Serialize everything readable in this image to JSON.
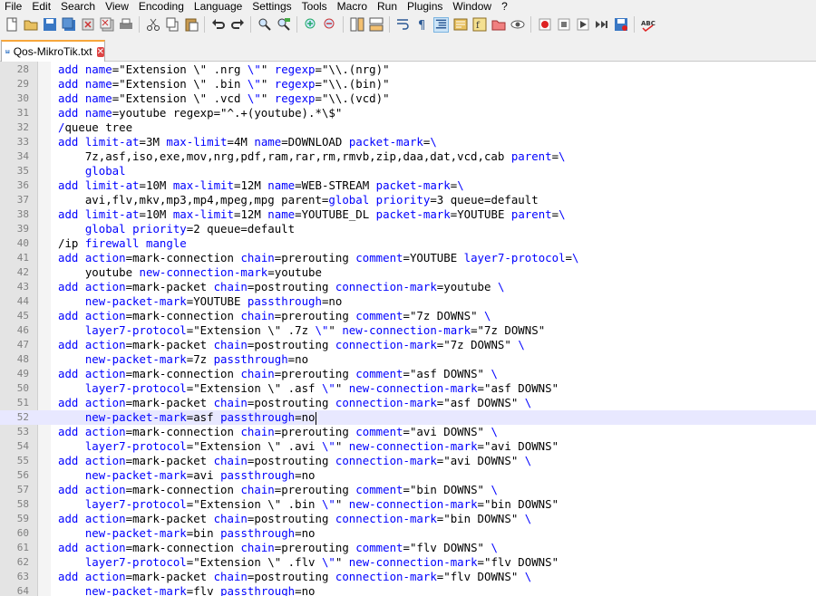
{
  "menu": [
    "File",
    "Edit",
    "Search",
    "View",
    "Encoding",
    "Language",
    "Settings",
    "Tools",
    "Macro",
    "Run",
    "Plugins",
    "Window",
    "?"
  ],
  "toolbar": {
    "groups": [
      [
        "new-file-icon",
        "open-file-icon",
        "save-icon",
        "save-all-icon",
        "close-icon",
        "close-all-icon",
        "print-icon"
      ],
      [
        "cut-icon",
        "copy-icon",
        "paste-icon"
      ],
      [
        "undo-icon",
        "redo-icon"
      ],
      [
        "find-icon",
        "replace-icon"
      ],
      [
        "zoom-in-icon",
        "zoom-out-icon"
      ],
      [
        "sync-vertical-icon",
        "sync-horizontal-icon"
      ],
      [
        "word-wrap-icon",
        "show-all-characters-icon",
        "indent-guide-icon",
        "document-map-icon",
        "function-list-icon",
        "folder-workspace-icon",
        "monitoring-icon"
      ],
      [
        "record-macro-icon",
        "stop-recording-icon",
        "play-macro-icon",
        "run-macro-multiple-icon",
        "save-macro-icon"
      ],
      [
        "spell-check-icon"
      ]
    ],
    "active": [
      "indent-guide-icon"
    ],
    "spell_label": "ABC"
  },
  "tab": {
    "label": "Qos-MikroTik.txt"
  },
  "current_line": 52,
  "lines": [
    {
      "n": "28",
      "t": [
        [
          "kw",
          "add "
        ],
        [
          "kw",
          "name"
        ],
        [
          "v",
          "=\"Extension \\\" .nrg "
        ],
        [
          "kw",
          "\\\""
        ],
        [
          "v",
          "\" "
        ],
        [
          "kw",
          "regexp"
        ],
        [
          "v",
          "=\"\\\\.(nrg)\""
        ]
      ]
    },
    {
      "n": "29",
      "t": [
        [
          "kw",
          "add "
        ],
        [
          "kw",
          "name"
        ],
        [
          "v",
          "=\"Extension \\\" .bin "
        ],
        [
          "kw",
          "\\\""
        ],
        [
          "v",
          "\" "
        ],
        [
          "kw",
          "regexp"
        ],
        [
          "v",
          "=\"\\\\.(bin)\""
        ]
      ]
    },
    {
      "n": "30",
      "t": [
        [
          "kw",
          "add "
        ],
        [
          "kw",
          "name"
        ],
        [
          "v",
          "=\"Extension \\\" .vcd "
        ],
        [
          "kw",
          "\\\""
        ],
        [
          "v",
          "\" "
        ],
        [
          "kw",
          "regexp"
        ],
        [
          "v",
          "=\"\\\\.(vcd)\""
        ]
      ]
    },
    {
      "n": "31",
      "t": [
        [
          "kw",
          "add "
        ],
        [
          "kw",
          "name"
        ],
        [
          "v",
          "=youtube regexp=\"^.+(youtube).*\\$\""
        ]
      ]
    },
    {
      "n": "32",
      "t": [
        [
          "kw",
          "/"
        ],
        [
          "v",
          "queue tree"
        ]
      ]
    },
    {
      "n": "33",
      "t": [
        [
          "kw",
          "add "
        ],
        [
          "kw",
          "limit-at"
        ],
        [
          "v",
          "=3M "
        ],
        [
          "kw",
          "max-limit"
        ],
        [
          "v",
          "=4M "
        ],
        [
          "kw",
          "name"
        ],
        [
          "v",
          "=DOWNLOAD "
        ],
        [
          "kw",
          "packet-mark"
        ],
        [
          "v",
          "="
        ],
        [
          "kw",
          "\\"
        ]
      ]
    },
    {
      "n": "34",
      "t": [
        [
          "v",
          "    7z,asf,iso,exe,mov,nrg,pdf,ram,rar,rm,rmvb,zip,daa,dat,vcd,cab "
        ],
        [
          "kw",
          "parent"
        ],
        [
          "v",
          "="
        ],
        [
          "kw",
          "\\"
        ]
      ]
    },
    {
      "n": "35",
      "t": [
        [
          "kw",
          "    global"
        ]
      ]
    },
    {
      "n": "36",
      "t": [
        [
          "kw",
          "add "
        ],
        [
          "kw",
          "limit-at"
        ],
        [
          "v",
          "=10M "
        ],
        [
          "kw",
          "max-limit"
        ],
        [
          "v",
          "=12M "
        ],
        [
          "kw",
          "name"
        ],
        [
          "v",
          "=WEB-STREAM "
        ],
        [
          "kw",
          "packet-mark"
        ],
        [
          "v",
          "="
        ],
        [
          "kw",
          "\\"
        ]
      ]
    },
    {
      "n": "37",
      "t": [
        [
          "v",
          "    avi,flv,mkv,mp3,mp4,mpeg,mpg parent="
        ],
        [
          "kw",
          "global "
        ],
        [
          "kw",
          "priority"
        ],
        [
          "v",
          "=3 queue=default"
        ]
      ]
    },
    {
      "n": "38",
      "t": [
        [
          "kw",
          "add "
        ],
        [
          "kw",
          "limit-at"
        ],
        [
          "v",
          "=10M "
        ],
        [
          "kw",
          "max-limit"
        ],
        [
          "v",
          "=12M "
        ],
        [
          "kw",
          "name"
        ],
        [
          "v",
          "=YOUTUBE_DL "
        ],
        [
          "kw",
          "packet-mark"
        ],
        [
          "v",
          "=YOUTUBE "
        ],
        [
          "kw",
          "parent"
        ],
        [
          "v",
          "="
        ],
        [
          "kw",
          "\\"
        ]
      ]
    },
    {
      "n": "39",
      "t": [
        [
          "kw",
          "    global "
        ],
        [
          "kw",
          "priority"
        ],
        [
          "v",
          "=2 queue=default"
        ]
      ]
    },
    {
      "n": "40",
      "t": [
        [
          "v",
          "/ip "
        ],
        [
          "kw",
          "firewall mangle"
        ]
      ]
    },
    {
      "n": "41",
      "t": [
        [
          "kw",
          "add "
        ],
        [
          "kw",
          "action"
        ],
        [
          "v",
          "=mark-connection "
        ],
        [
          "kw",
          "chain"
        ],
        [
          "v",
          "=prerouting "
        ],
        [
          "kw",
          "comment"
        ],
        [
          "v",
          "=YOUTUBE "
        ],
        [
          "kw",
          "layer7-protocol"
        ],
        [
          "v",
          "="
        ],
        [
          "kw",
          "\\"
        ]
      ]
    },
    {
      "n": "42",
      "t": [
        [
          "v",
          "    youtube "
        ],
        [
          "kw",
          "new-connection-mark"
        ],
        [
          "v",
          "=youtube"
        ]
      ]
    },
    {
      "n": "43",
      "t": [
        [
          "kw",
          "add "
        ],
        [
          "kw",
          "action"
        ],
        [
          "v",
          "=mark-packet "
        ],
        [
          "kw",
          "chain"
        ],
        [
          "v",
          "=postrouting "
        ],
        [
          "kw",
          "connection-mark"
        ],
        [
          "v",
          "=youtube "
        ],
        [
          "kw",
          "\\"
        ]
      ]
    },
    {
      "n": "44",
      "t": [
        [
          "kw",
          "    new-packet-mark"
        ],
        [
          "v",
          "=YOUTUBE "
        ],
        [
          "kw",
          "passthrough"
        ],
        [
          "v",
          "=no"
        ]
      ]
    },
    {
      "n": "45",
      "t": [
        [
          "kw",
          "add "
        ],
        [
          "kw",
          "action"
        ],
        [
          "v",
          "=mark-connection "
        ],
        [
          "kw",
          "chain"
        ],
        [
          "v",
          "=prerouting "
        ],
        [
          "kw",
          "comment"
        ],
        [
          "v",
          "=\"7z DOWNS\" "
        ],
        [
          "kw",
          "\\"
        ]
      ]
    },
    {
      "n": "46",
      "t": [
        [
          "kw",
          "    layer7-protocol"
        ],
        [
          "v",
          "=\"Extension \\\" .7z "
        ],
        [
          "kw",
          "\\\""
        ],
        [
          "v",
          "\" "
        ],
        [
          "kw",
          "new-connection-mark"
        ],
        [
          "v",
          "=\"7z DOWNS\""
        ]
      ]
    },
    {
      "n": "47",
      "t": [
        [
          "kw",
          "add "
        ],
        [
          "kw",
          "action"
        ],
        [
          "v",
          "=mark-packet "
        ],
        [
          "kw",
          "chain"
        ],
        [
          "v",
          "=postrouting "
        ],
        [
          "kw",
          "connection-mark"
        ],
        [
          "v",
          "=\"7z DOWNS\" "
        ],
        [
          "kw",
          "\\"
        ]
      ]
    },
    {
      "n": "48",
      "t": [
        [
          "kw",
          "    new-packet-mark"
        ],
        [
          "v",
          "=7z "
        ],
        [
          "kw",
          "passthrough"
        ],
        [
          "v",
          "=no"
        ]
      ]
    },
    {
      "n": "49",
      "t": [
        [
          "kw",
          "add "
        ],
        [
          "kw",
          "action"
        ],
        [
          "v",
          "=mark-connection "
        ],
        [
          "kw",
          "chain"
        ],
        [
          "v",
          "=prerouting "
        ],
        [
          "kw",
          "comment"
        ],
        [
          "v",
          "=\"asf DOWNS\" "
        ],
        [
          "kw",
          "\\"
        ]
      ]
    },
    {
      "n": "50",
      "t": [
        [
          "kw",
          "    layer7-protocol"
        ],
        [
          "v",
          "=\"Extension \\\" .asf "
        ],
        [
          "kw",
          "\\\""
        ],
        [
          "v",
          "\" "
        ],
        [
          "kw",
          "new-connection-mark"
        ],
        [
          "v",
          "=\"asf DOWNS\""
        ]
      ]
    },
    {
      "n": "51",
      "t": [
        [
          "kw",
          "add "
        ],
        [
          "kw",
          "action"
        ],
        [
          "v",
          "=mark-packet "
        ],
        [
          "kw",
          "chain"
        ],
        [
          "v",
          "=postrouting "
        ],
        [
          "kw",
          "connection-mark"
        ],
        [
          "v",
          "=\"asf DOWNS\" "
        ],
        [
          "kw",
          "\\"
        ]
      ]
    },
    {
      "n": "52",
      "t": [
        [
          "kw",
          "    new-packet-mark"
        ],
        [
          "v",
          "=asf "
        ],
        [
          "kw",
          "passthrough"
        ],
        [
          "v",
          "=no"
        ]
      ]
    },
    {
      "n": "53",
      "t": [
        [
          "kw",
          "add "
        ],
        [
          "kw",
          "action"
        ],
        [
          "v",
          "=mark-connection "
        ],
        [
          "kw",
          "chain"
        ],
        [
          "v",
          "=prerouting "
        ],
        [
          "kw",
          "comment"
        ],
        [
          "v",
          "=\"avi DOWNS\" "
        ],
        [
          "kw",
          "\\"
        ]
      ]
    },
    {
      "n": "54",
      "t": [
        [
          "kw",
          "    layer7-protocol"
        ],
        [
          "v",
          "=\"Extension \\\" .avi "
        ],
        [
          "kw",
          "\\\""
        ],
        [
          "v",
          "\" "
        ],
        [
          "kw",
          "new-connection-mark"
        ],
        [
          "v",
          "=\"avi DOWNS\""
        ]
      ]
    },
    {
      "n": "55",
      "t": [
        [
          "kw",
          "add "
        ],
        [
          "kw",
          "action"
        ],
        [
          "v",
          "=mark-packet "
        ],
        [
          "kw",
          "chain"
        ],
        [
          "v",
          "=postrouting "
        ],
        [
          "kw",
          "connection-mark"
        ],
        [
          "v",
          "=\"avi DOWNS\" "
        ],
        [
          "kw",
          "\\"
        ]
      ]
    },
    {
      "n": "56",
      "t": [
        [
          "kw",
          "    new-packet-mark"
        ],
        [
          "v",
          "=avi "
        ],
        [
          "kw",
          "passthrough"
        ],
        [
          "v",
          "=no"
        ]
      ]
    },
    {
      "n": "57",
      "t": [
        [
          "kw",
          "add "
        ],
        [
          "kw",
          "action"
        ],
        [
          "v",
          "=mark-connection "
        ],
        [
          "kw",
          "chain"
        ],
        [
          "v",
          "=prerouting "
        ],
        [
          "kw",
          "comment"
        ],
        [
          "v",
          "=\"bin DOWNS\" "
        ],
        [
          "kw",
          "\\"
        ]
      ]
    },
    {
      "n": "58",
      "t": [
        [
          "kw",
          "    layer7-protocol"
        ],
        [
          "v",
          "=\"Extension \\\" .bin "
        ],
        [
          "kw",
          "\\\""
        ],
        [
          "v",
          "\" "
        ],
        [
          "kw",
          "new-connection-mark"
        ],
        [
          "v",
          "=\"bin DOWNS\""
        ]
      ]
    },
    {
      "n": "59",
      "t": [
        [
          "kw",
          "add "
        ],
        [
          "kw",
          "action"
        ],
        [
          "v",
          "=mark-packet "
        ],
        [
          "kw",
          "chain"
        ],
        [
          "v",
          "=postrouting "
        ],
        [
          "kw",
          "connection-mark"
        ],
        [
          "v",
          "=\"bin DOWNS\" "
        ],
        [
          "kw",
          "\\"
        ]
      ]
    },
    {
      "n": "60",
      "t": [
        [
          "kw",
          "    new-packet-mark"
        ],
        [
          "v",
          "=bin "
        ],
        [
          "kw",
          "passthrough"
        ],
        [
          "v",
          "=no"
        ]
      ]
    },
    {
      "n": "61",
      "t": [
        [
          "kw",
          "add "
        ],
        [
          "kw",
          "action"
        ],
        [
          "v",
          "=mark-connection "
        ],
        [
          "kw",
          "chain"
        ],
        [
          "v",
          "=prerouting "
        ],
        [
          "kw",
          "comment"
        ],
        [
          "v",
          "=\"flv DOWNS\" "
        ],
        [
          "kw",
          "\\"
        ]
      ]
    },
    {
      "n": "62",
      "t": [
        [
          "kw",
          "    layer7-protocol"
        ],
        [
          "v",
          "=\"Extension \\\" .flv "
        ],
        [
          "kw",
          "\\\""
        ],
        [
          "v",
          "\" "
        ],
        [
          "kw",
          "new-connection-mark"
        ],
        [
          "v",
          "=\"flv DOWNS\""
        ]
      ]
    },
    {
      "n": "63",
      "t": [
        [
          "kw",
          "add "
        ],
        [
          "kw",
          "action"
        ],
        [
          "v",
          "=mark-packet "
        ],
        [
          "kw",
          "chain"
        ],
        [
          "v",
          "=postrouting "
        ],
        [
          "kw",
          "connection-mark"
        ],
        [
          "v",
          "=\"flv DOWNS\" "
        ],
        [
          "kw",
          "\\"
        ]
      ]
    },
    {
      "n": "64",
      "t": [
        [
          "kw",
          "    new-packet-mark"
        ],
        [
          "v",
          "=flv "
        ],
        [
          "kw",
          "passthrough"
        ],
        [
          "v",
          "=no"
        ]
      ]
    }
  ]
}
